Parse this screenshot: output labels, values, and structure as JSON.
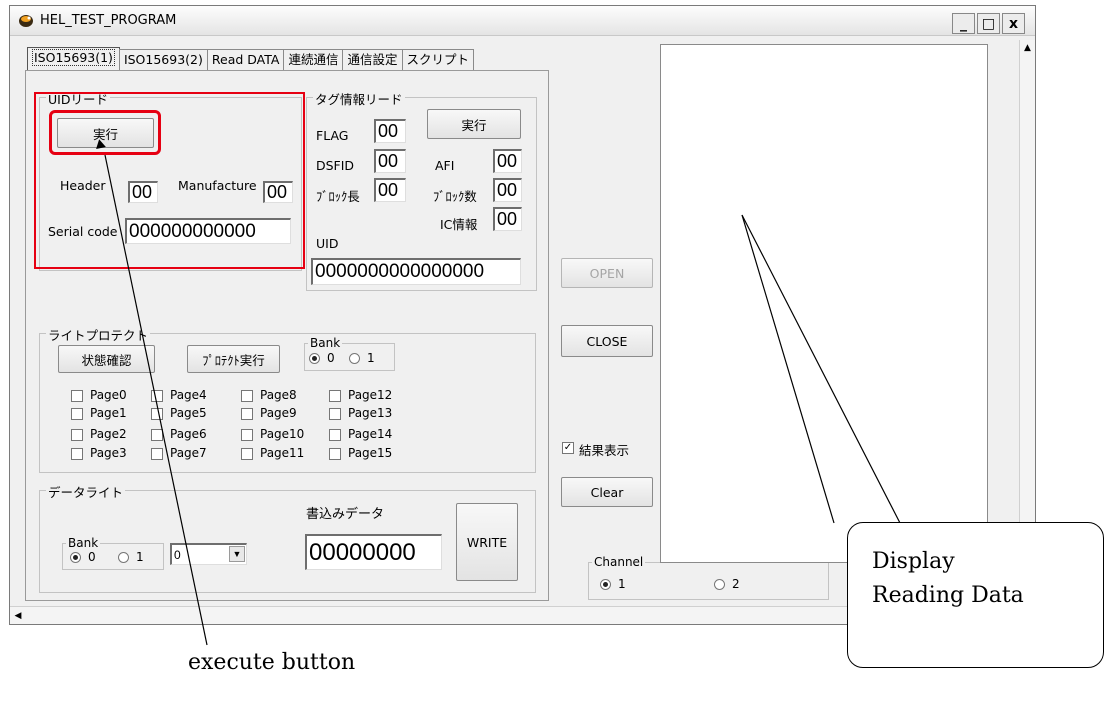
{
  "window": {
    "title": "HEL_TEST_PROGRAM",
    "minimize": "_",
    "maximize": "□",
    "close": "x"
  },
  "tabs": [
    "ISO15693(1)",
    "ISO15693(2)",
    "Read DATA",
    "連続通信",
    "通信設定",
    "スクリプト"
  ],
  "uid_read": {
    "legend": "UIDリード",
    "execute": "実行",
    "header_label": "Header",
    "header_value": "00",
    "manufacture_label": "Manufacture",
    "manufacture_value": "00",
    "serial_label": "Serial code",
    "serial_value": "000000000000"
  },
  "tag_info": {
    "legend": "タグ情報リード",
    "execute": "実行",
    "flag_label": "FLAG",
    "flag_value": "00",
    "dsfid_label": "DSFID",
    "dsfid_value": "00",
    "afi_label": "AFI",
    "afi_value": "00",
    "block_len_label": "ﾌﾞﾛｯｸ長",
    "block_len_value": "00",
    "block_count_label": "ﾌﾞﾛｯｸ数",
    "block_count_value": "00",
    "ic_info_label": "IC情報",
    "ic_info_value": "00",
    "uid_label": "UID",
    "uid_value": "0000000000000000"
  },
  "write_protect": {
    "legend": "ライトプロテクト",
    "status_button": "状態確認",
    "protect_button": "ﾌﾟﾛﾃｸﾄ実行",
    "bank_legend": "Bank",
    "bank_options": [
      "0",
      "1"
    ],
    "pages": [
      [
        "Page0",
        "Page1",
        "Page2",
        "Page3"
      ],
      [
        "Page4",
        "Page5",
        "Page6",
        "Page7"
      ],
      [
        "Page8",
        "Page9",
        "Page10",
        "Page11"
      ],
      [
        "Page12",
        "Page13",
        "Page14",
        "Page15"
      ]
    ]
  },
  "data_write": {
    "legend": "データライト",
    "bank_legend": "Bank",
    "bank_options": [
      "0",
      "1"
    ],
    "select_value": "0",
    "write_data_label": "書込みデータ",
    "write_data_value": "00000000",
    "write_button": "WRITE"
  },
  "side": {
    "open": "OPEN",
    "close": "CLOSE",
    "result_display": "結果表示",
    "result_checked": true,
    "clear": "Clear"
  },
  "channel": {
    "legend": "Channel",
    "options": [
      "1",
      "2"
    ]
  },
  "annotations": {
    "display_line1": "Display",
    "display_line2": "Reading Data",
    "execute_caption": "execute button"
  },
  "colors": {
    "highlight": "#e60012"
  }
}
